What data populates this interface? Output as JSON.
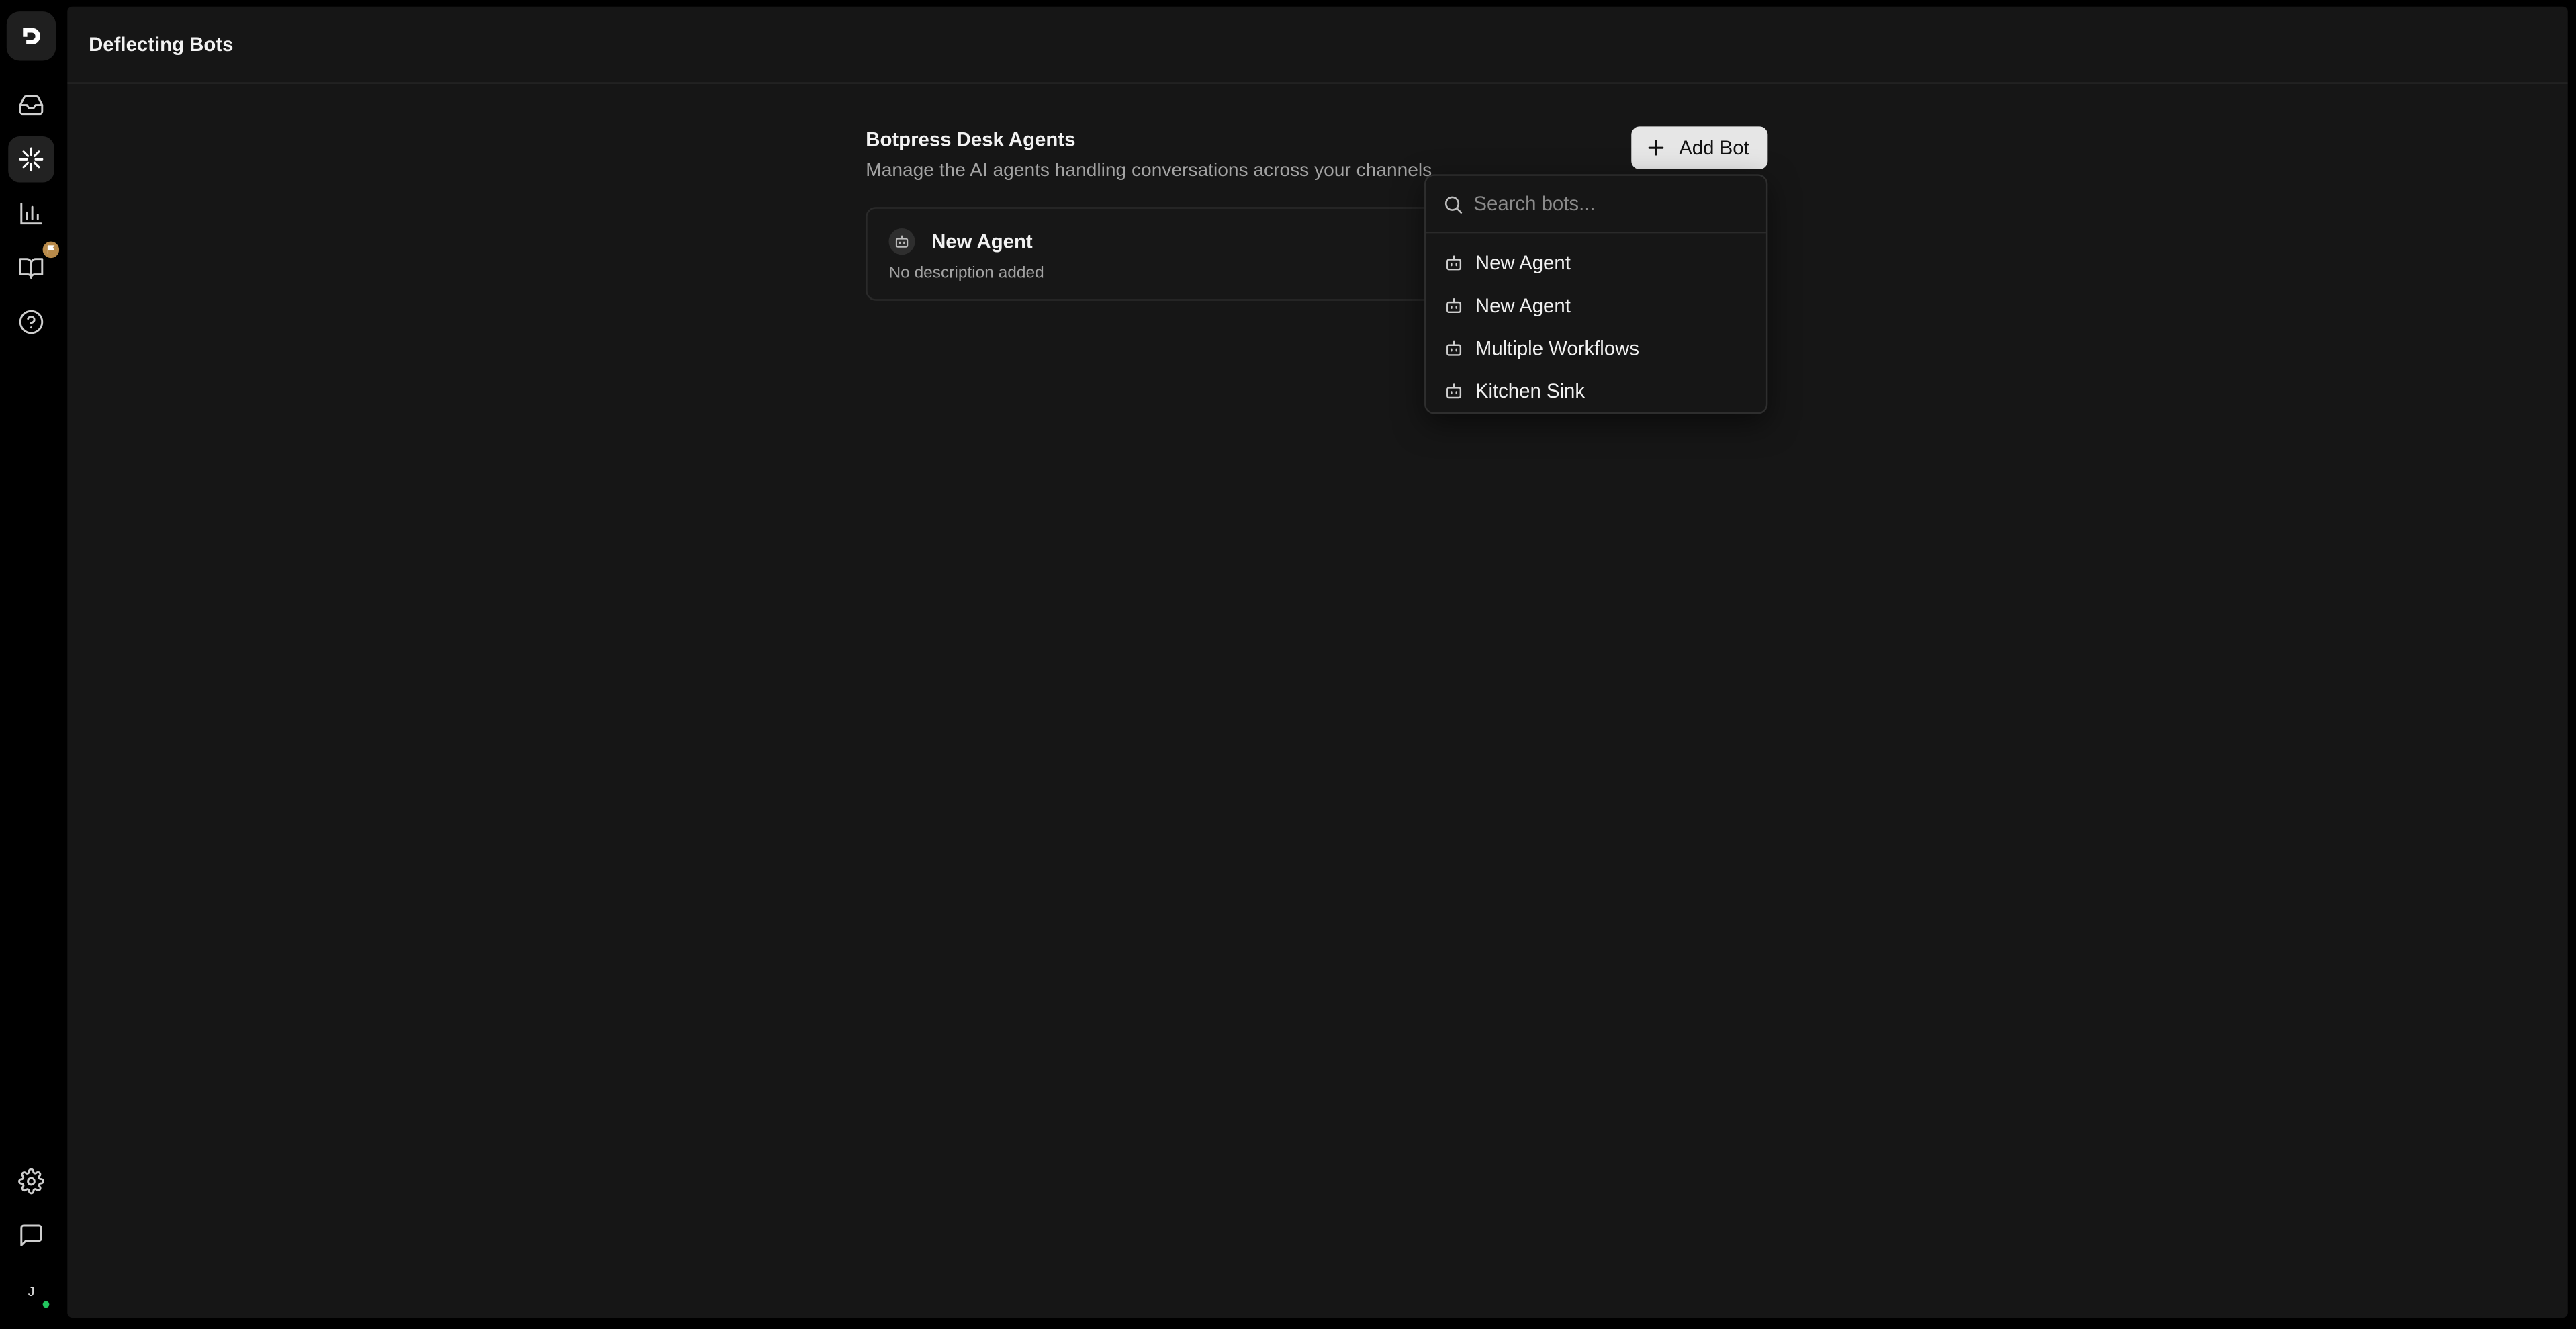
{
  "window": {
    "page_title": "Deflecting Bots"
  },
  "sidebar": {
    "logo_icon": "botpress-logo-icon",
    "items": [
      {
        "name": "inbox",
        "icon": "inbox-icon",
        "active": false
      },
      {
        "name": "bots",
        "icon": "sparkle-icon",
        "active": true
      },
      {
        "name": "analytics",
        "icon": "bar-chart-icon",
        "active": false
      },
      {
        "name": "knowledge",
        "icon": "book-icon",
        "active": false,
        "badge": true
      },
      {
        "name": "help",
        "icon": "help-circle-icon",
        "active": false
      }
    ],
    "bottom_items": [
      {
        "name": "settings",
        "icon": "gear-icon"
      },
      {
        "name": "feedback",
        "icon": "message-square-icon"
      }
    ],
    "avatar_initial": "J",
    "status_color": "#22c55e"
  },
  "section": {
    "title": "Botpress Desk Agents",
    "description": "Manage the AI agents handling conversations across your channels"
  },
  "add_bot_button": {
    "label": "Add Bot",
    "icon": "plus-icon"
  },
  "agent_card": {
    "name": "New Agent",
    "description": "No description added",
    "icon": "bot-icon"
  },
  "dropdown": {
    "search_placeholder": "Search bots...",
    "search_value": "",
    "options": [
      {
        "label": "New Agent",
        "icon": "bot-icon"
      },
      {
        "label": "New Agent",
        "icon": "bot-icon"
      },
      {
        "label": "Multiple Workflows",
        "icon": "bot-icon"
      },
      {
        "label": "Kitchen Sink",
        "icon": "bot-icon"
      }
    ]
  },
  "colors": {
    "background": "#000000",
    "panel": "#161616",
    "button_bg": "#e6e6e6",
    "badge": "#b88a4a"
  }
}
